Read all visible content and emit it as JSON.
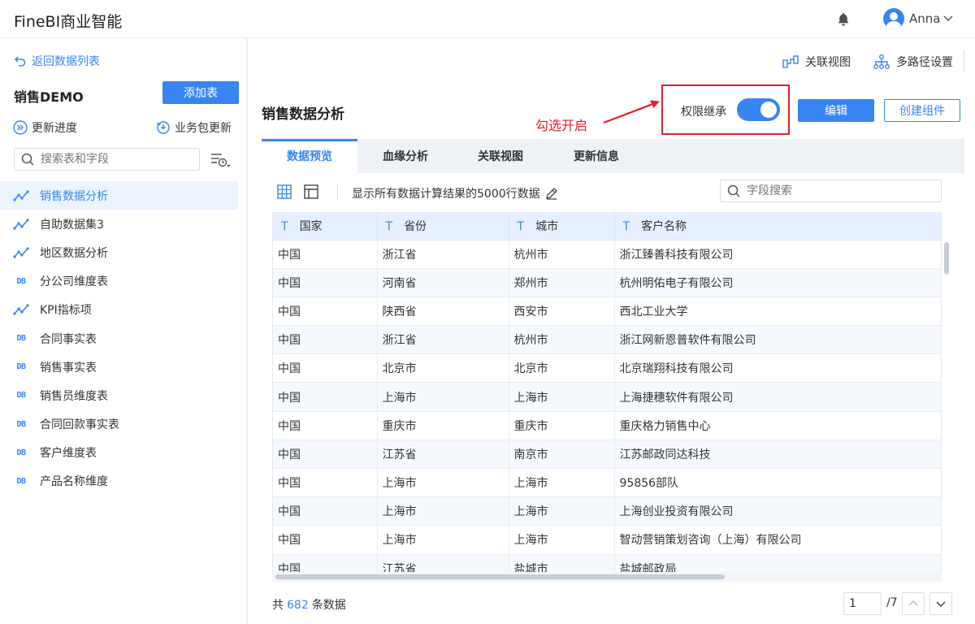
{
  "app": {
    "title": "FineBI商业智能",
    "user": "Anna"
  },
  "sidebar": {
    "back_label": "返回数据列表",
    "package_name": "销售DEMO",
    "add_table_label": "添加表",
    "update_progress_label": "更新进度",
    "package_update_label": "业务包更新",
    "search_placeholder": "搜索表和字段",
    "tables": [
      {
        "label": "销售数据分析",
        "icon": "self-dataset-icon",
        "active": true
      },
      {
        "label": "自助数据集3",
        "icon": "self-dataset-icon"
      },
      {
        "label": "地区数据分析",
        "icon": "self-dataset-icon"
      },
      {
        "label": "分公司维度表",
        "icon": "db-table-icon"
      },
      {
        "label": "KPI指标项",
        "icon": "self-dataset-icon"
      },
      {
        "label": "合同事实表",
        "icon": "db-table-icon"
      },
      {
        "label": "销售事实表",
        "icon": "db-table-icon"
      },
      {
        "label": "销售员维度表",
        "icon": "db-table-icon"
      },
      {
        "label": "合同回款事实表",
        "icon": "db-table-icon"
      },
      {
        "label": "客户维度表",
        "icon": "db-table-icon"
      },
      {
        "label": "产品名称维度",
        "icon": "db-table-icon"
      }
    ]
  },
  "header": {
    "relation_view_label": "关联视图",
    "multipath_label": "多路径设置"
  },
  "main": {
    "title": "销售数据分析",
    "annotation": "勾选开启",
    "permission_label": "权限继承",
    "permission_on": true,
    "edit_label": "编辑",
    "create_component_label": "创建组件",
    "tabs": [
      "数据预览",
      "血缘分析",
      "关联视图",
      "更新信息"
    ],
    "active_tab": 0,
    "preview_text": "显示所有数据计算结果的5000行数据",
    "field_search_placeholder": "字段搜索",
    "columns": [
      "国家",
      "省份",
      "城市",
      "客户名称"
    ],
    "rows": [
      [
        "中国",
        "浙江省",
        "杭州市",
        "浙江臻善科技有限公司"
      ],
      [
        "中国",
        "河南省",
        "郑州市",
        "杭州明佑电子有限公司"
      ],
      [
        "中国",
        "陕西省",
        "西安市",
        "西北工业大学"
      ],
      [
        "中国",
        "浙江省",
        "杭州市",
        "浙江网新恩普软件有限公司"
      ],
      [
        "中国",
        "北京市",
        "北京市",
        "北京瑞翔科技有限公司"
      ],
      [
        "中国",
        "上海市",
        "上海市",
        "上海捷穗软件有限公司"
      ],
      [
        "中国",
        "重庆市",
        "重庆市",
        "重庆格力销售中心"
      ],
      [
        "中国",
        "江苏省",
        "南京市",
        "江苏邮政同达科技"
      ],
      [
        "中国",
        "上海市",
        "上海市",
        "95856部队"
      ],
      [
        "中国",
        "上海市",
        "上海市",
        "上海创业投资有限公司"
      ],
      [
        "中国",
        "上海市",
        "上海市",
        "智动营销策划咨询（上海）有限公司"
      ],
      [
        "中国",
        "江苏省",
        "盐城市",
        "盐城邮政局"
      ]
    ],
    "footer_prefix": "共",
    "total_count": "682",
    "footer_suffix": "条数据",
    "page_current": "1",
    "page_total": "/7"
  },
  "colors": {
    "accent": "#3685f2",
    "annotation": "#e0202a"
  }
}
